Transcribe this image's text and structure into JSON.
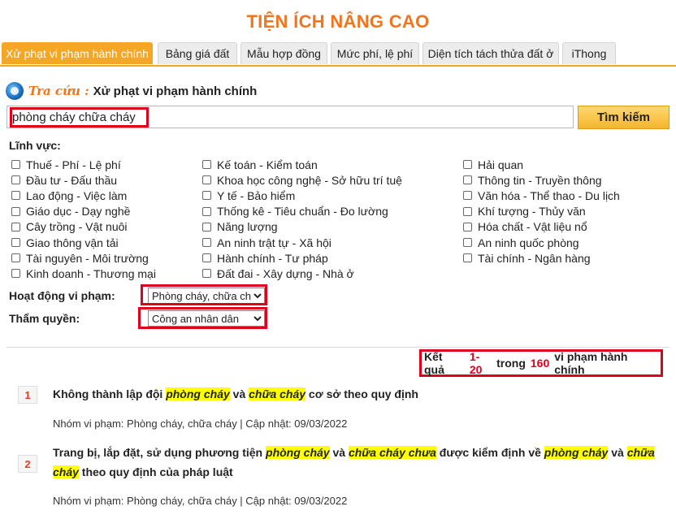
{
  "page": {
    "title": "TIỆN ÍCH NÂNG CAO"
  },
  "tabs": [
    {
      "label": "Xử phạt vi phạm hành chính",
      "active": true
    },
    {
      "label": "Bảng giá đất"
    },
    {
      "label": "Mẫu hợp đồng"
    },
    {
      "label": "Mức phí, lệ phí"
    },
    {
      "label": "Diện tích tách thửa đất ở"
    },
    {
      "label": "iThong"
    }
  ],
  "search": {
    "tra_cuu": "Tra cứu :",
    "heading": "Xử phạt vi phạm hành chính",
    "value": "phòng cháy chữa cháy",
    "button": "Tìm kiếm"
  },
  "fields": {
    "label": "Lĩnh vực:",
    "col1": [
      "Thuế - Phí - Lệ phí",
      "Đầu tư - Đấu thầu",
      "Lao động - Việc làm",
      "Giáo dục - Dạy nghề",
      "Cây trồng - Vật nuôi",
      "Giao thông vận tải",
      "Tài nguyên - Môi trường",
      "Kinh doanh - Thương mại"
    ],
    "col2": [
      "Kế toán - Kiểm toán",
      "Khoa học công nghệ - Sở hữu trí tuệ",
      "Y tế - Bảo hiểm",
      "Thống kê - Tiêu chuẩn - Đo lường",
      "Năng lượng",
      "An ninh trật tự - Xã hội",
      "Hành chính - Tư pháp",
      "Đất đai - Xây dựng - Nhà ở"
    ],
    "col3": [
      "Hải quan",
      "Thông tin - Truyền thông",
      "Văn hóa - Thể thao - Du lịch",
      "Khí tượng - Thủy văn",
      "Hóa chất - Vật liệu nổ",
      "An ninh quốc phòng",
      "Tài chính - Ngân hàng"
    ]
  },
  "filters": {
    "activity_label": "Hoạt động vi phạm:",
    "activity_value": "Phòng cháy, chữa ch",
    "authority_label": "Thẩm quyền:",
    "authority_value": "Công an nhân dân"
  },
  "results": {
    "prefix": "Kết quả",
    "range": "1-20",
    "mid": "trong",
    "total": "160",
    "suffix": "vi phạm hành chính"
  },
  "items": [
    {
      "num": "1",
      "title_parts": [
        {
          "t": "Không thành lập đội ",
          "hl": false
        },
        {
          "t": "phòng cháy",
          "hl": true
        },
        {
          "t": " và ",
          "hl": false
        },
        {
          "t": "chữa cháy",
          "hl": true
        },
        {
          "t": " cơ sở theo quy định",
          "hl": false
        }
      ],
      "meta": "Nhóm vi phạm: Phòng cháy, chữa cháy  |  Cập nhật: 09/03/2022"
    },
    {
      "num": "2",
      "title_parts": [
        {
          "t": "Trang bị, lắp đặt, sử dụng phương tiện ",
          "hl": false
        },
        {
          "t": "phòng cháy",
          "hl": true
        },
        {
          "t": " và ",
          "hl": false
        },
        {
          "t": "chữa cháy chưa",
          "hl": true
        },
        {
          "t": " được kiểm định về ",
          "hl": false
        },
        {
          "t": "phòng cháy",
          "hl": true
        },
        {
          "t": " và ",
          "hl": false
        },
        {
          "t": "chữa cháy",
          "hl": true
        },
        {
          "t": " theo quy định của pháp luật",
          "hl": false
        }
      ],
      "meta": "Nhóm vi phạm: Phòng cháy, chữa cháy  |  Cập nhật: 09/03/2022"
    }
  ]
}
